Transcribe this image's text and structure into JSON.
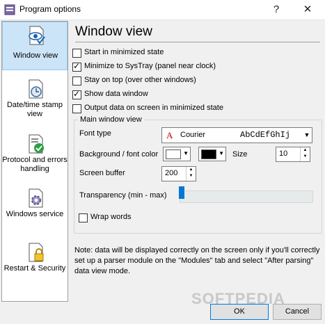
{
  "window": {
    "title": "Program options",
    "help_symbol": "?",
    "close_symbol": "✕"
  },
  "sidebar": {
    "items": [
      {
        "label": "Window view",
        "icon": "eye-document-icon",
        "active": true
      },
      {
        "label": "Date/time stamp view",
        "icon": "clock-document-icon",
        "active": false
      },
      {
        "label": "Protocol and errors handling",
        "icon": "check-document-icon",
        "active": false
      },
      {
        "label": "Windows service",
        "icon": "gear-document-icon",
        "active": false
      },
      {
        "label": "Restart & Security",
        "icon": "lock-document-icon",
        "active": false
      }
    ]
  },
  "main": {
    "section_title": "Window view",
    "options": [
      {
        "label": "Start in minimized state",
        "checked": false
      },
      {
        "label": "Minimize to SysTray (panel near clock)",
        "checked": true
      },
      {
        "label": "Stay on top (over other windows)",
        "checked": false
      },
      {
        "label": "Show data window",
        "checked": true
      },
      {
        "label": "Output data on screen in minimized state",
        "checked": false
      }
    ],
    "group": {
      "title": "Main window view",
      "font_type_label": "Font type",
      "font_name": "Courier",
      "font_sample": "AbCdEfGhIj",
      "font_glyph": "A",
      "bg_font_color_label": "Background / font color",
      "background_color": "#ffffff",
      "font_color": "#000000",
      "size_label": "Size",
      "size_value": "10",
      "screen_buffer_label": "Screen buffer",
      "screen_buffer_value": "200",
      "transparency_label": "Transparency (min - max)",
      "transparency_level": 0,
      "wrap_words_label": "Wrap words",
      "wrap_words_checked": false
    },
    "note": "Note: data will be displayed correctly on the screen only if you'll correctly set up a parser module on the \"Modules\" tab and select \"After parsing\" data view mode."
  },
  "buttons": {
    "ok": "OK",
    "cancel": "Cancel"
  },
  "watermark": "SOFTPEDIA",
  "colors": {
    "accent": "#0078d7",
    "selection": "#cce4f7"
  }
}
